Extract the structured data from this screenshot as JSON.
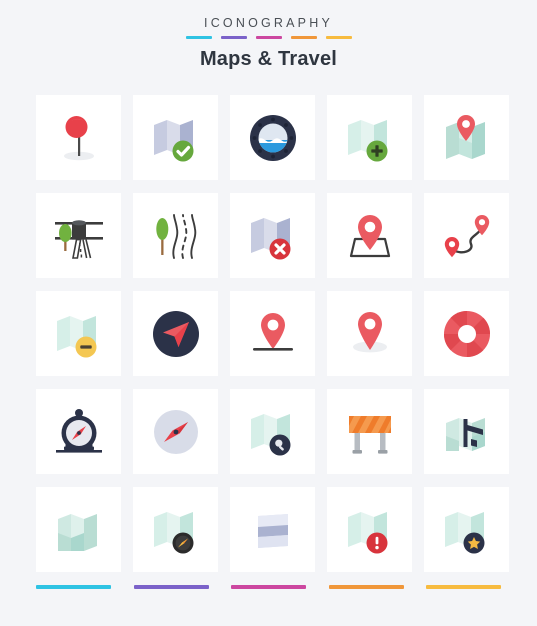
{
  "header": {
    "eyebrow": "ICONOGRAPHY",
    "title": "Maps & Travel",
    "rule_colors": [
      "#2fc3e3",
      "#7b62c9",
      "#cc47a0",
      "#f0973a",
      "#f7bb3f"
    ]
  },
  "footer": {
    "bar_colors": [
      "#2fc3e3",
      "#7b62c9",
      "#cc47a0",
      "#f0973a",
      "#f7bb3f"
    ]
  },
  "palette": {
    "background": "#f4f5f8",
    "tile": "#ffffff",
    "red": "#e8414a",
    "pin_red": "#ea5a61",
    "navy": "#2b3248",
    "green": "#66a83d",
    "yellow": "#f4c752",
    "mint": "#cfe9e2",
    "mint_dark": "#a9d7cd",
    "lavender": "#c6cbe0",
    "lavender_dark": "#aab2d0",
    "orange": "#ef7c2b",
    "gray": "#9aa0a6",
    "dark": "#3c3c3c"
  },
  "icons": [
    {
      "row": 1,
      "col": 1,
      "name": "map-pin-marker-icon",
      "label": "Push pin marker"
    },
    {
      "row": 1,
      "col": 2,
      "name": "map-check-icon",
      "label": "Map approved"
    },
    {
      "row": 1,
      "col": 3,
      "name": "porthole-window-icon",
      "label": "Ship porthole"
    },
    {
      "row": 1,
      "col": 4,
      "name": "map-add-icon",
      "label": "Add map"
    },
    {
      "row": 1,
      "col": 5,
      "name": "map-location-pin-icon",
      "label": "Map with location pin"
    },
    {
      "row": 2,
      "col": 1,
      "name": "road-bridge-tree-icon",
      "label": "Road bridge with tree"
    },
    {
      "row": 2,
      "col": 2,
      "name": "winding-road-tree-icon",
      "label": "Winding road with tree"
    },
    {
      "row": 2,
      "col": 3,
      "name": "map-delete-icon",
      "label": "Delete map"
    },
    {
      "row": 2,
      "col": 4,
      "name": "pin-on-map-outline-icon",
      "label": "Pin on map outline"
    },
    {
      "row": 2,
      "col": 5,
      "name": "route-two-pins-icon",
      "label": "Route between two pins"
    },
    {
      "row": 3,
      "col": 1,
      "name": "map-remove-icon",
      "label": "Remove from map"
    },
    {
      "row": 3,
      "col": 2,
      "name": "navigation-arrow-icon",
      "label": "Navigation arrow"
    },
    {
      "row": 3,
      "col": 3,
      "name": "pin-on-line-icon",
      "label": "Pin on baseline"
    },
    {
      "row": 3,
      "col": 4,
      "name": "pin-shadow-icon",
      "label": "Pin with shadow"
    },
    {
      "row": 3,
      "col": 5,
      "name": "life-ring-icon",
      "label": "Life ring"
    },
    {
      "row": 4,
      "col": 1,
      "name": "stopwatch-compass-icon",
      "label": "Pocket compass"
    },
    {
      "row": 4,
      "col": 2,
      "name": "compass-circle-icon",
      "label": "Compass dial"
    },
    {
      "row": 4,
      "col": 3,
      "name": "map-search-icon",
      "label": "Search map"
    },
    {
      "row": 4,
      "col": 4,
      "name": "road-barrier-icon",
      "label": "Road barrier"
    },
    {
      "row": 4,
      "col": 5,
      "name": "map-signpost-icon",
      "label": "Map with signpost"
    },
    {
      "row": 5,
      "col": 1,
      "name": "folded-map-icon",
      "label": "Folded map"
    },
    {
      "row": 5,
      "col": 2,
      "name": "map-compass-icon",
      "label": "Map with compass"
    },
    {
      "row": 5,
      "col": 3,
      "name": "map-sheet-icon",
      "label": "Map sheet"
    },
    {
      "row": 5,
      "col": 4,
      "name": "map-alert-icon",
      "label": "Map alert"
    },
    {
      "row": 5,
      "col": 5,
      "name": "map-favorite-icon",
      "label": "Favorite map"
    }
  ]
}
